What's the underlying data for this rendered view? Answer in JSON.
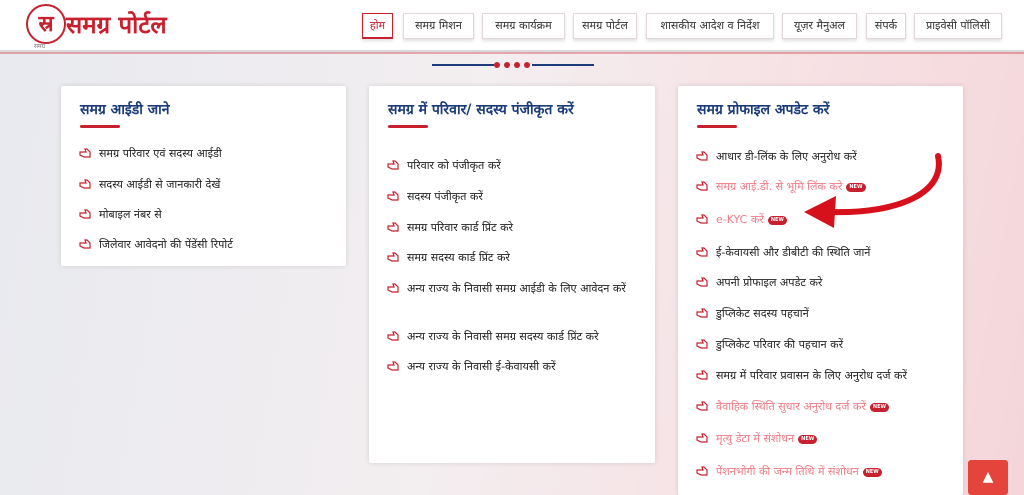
{
  "brand": {
    "logo_glyph": "स्र",
    "logo_sub": "समग्र",
    "title": "समग्र पोर्टल",
    "color": "#c7202f"
  },
  "nav": [
    {
      "label": "होम",
      "active": true
    },
    {
      "label": "समग्र मिशन"
    },
    {
      "label": "समग्र कार्यक्रम"
    },
    {
      "label": "समग्र पोर्टल"
    },
    {
      "label": "शासकीय आदेश व निर्देश"
    },
    {
      "label": "यूज़र मैनुअल"
    },
    {
      "label": "संपर्क"
    },
    {
      "label": "प्राइवेसी पॉलिसी"
    }
  ],
  "cards": [
    {
      "title": "समग्र आईडी जाने",
      "items": [
        {
          "label": "समग्र परिवार एवं सदस्य आईडी"
        },
        {
          "label": "सदस्य आईडी से जानकारी देखें"
        },
        {
          "label": "मोबाइल नंबर से"
        },
        {
          "label": "जिलेवार आवेदनो की पेंडेंसी रिपोर्ट"
        }
      ]
    },
    {
      "title": "समग्र में परिवार/ सदस्य पंजीकृत करें",
      "items": [
        {
          "label": "परिवार को पंजीकृत करें"
        },
        {
          "label": "सदस्य पंजीकृत करें"
        },
        {
          "label": "समग्र परिवार कार्ड प्रिंट करे"
        },
        {
          "label": "समग्र सदस्य कार्ड प्रिंट करे"
        },
        {
          "label": "अन्य राज्य के निवासी समग्र आईडी के लिए आवेदन करें"
        },
        {
          "label": "अन्य राज्य के निवासी समग्र सदस्य कार्ड प्रिंट करे"
        },
        {
          "label": "अन्य राज्य के निवासी ई-केवायसी करें"
        }
      ]
    },
    {
      "title": "समग्र प्रोफाइल अपडेट करें",
      "items": [
        {
          "label": "आधार डी-लिंक के लिए अनुरोध करें"
        },
        {
          "label": "समग्र आई.डी. से भूमि लिंक करे",
          "pink": true,
          "badge": "NEW"
        },
        {
          "label": "e-KYC करें",
          "pink": true,
          "badge": "NEW"
        },
        {
          "label": "ई-केवायसी और डीबीटी की स्थिति जानें"
        },
        {
          "label": "अपनी प्रोफाइल अपडेट करे"
        },
        {
          "label": "डुप्लिकेट सदस्य पहचानें"
        },
        {
          "label": "डुप्लिकेट परिवार की पहचान करें"
        },
        {
          "label": "समग्र में परिवार प्रवासन के लिए अनुरोध दर्ज करें"
        },
        {
          "label": "वैवाहिक स्थिति सुधार अनुरोध दर्ज करें",
          "pink": true,
          "badge": "NEW"
        },
        {
          "label": "मृत्यु डेटा में संशोधन",
          "pink": true,
          "badge": "NEW"
        },
        {
          "label": "पेंशनभोगी की जन्म तिथि में संशोधन",
          "pink": true,
          "badge": "NEW"
        }
      ]
    }
  ],
  "scroll_top_icon": "chevron-up-icon",
  "colors": {
    "accent": "#c7202f",
    "title_blue": "#1b3b7a",
    "highlight_pink": "#ee7b86"
  }
}
